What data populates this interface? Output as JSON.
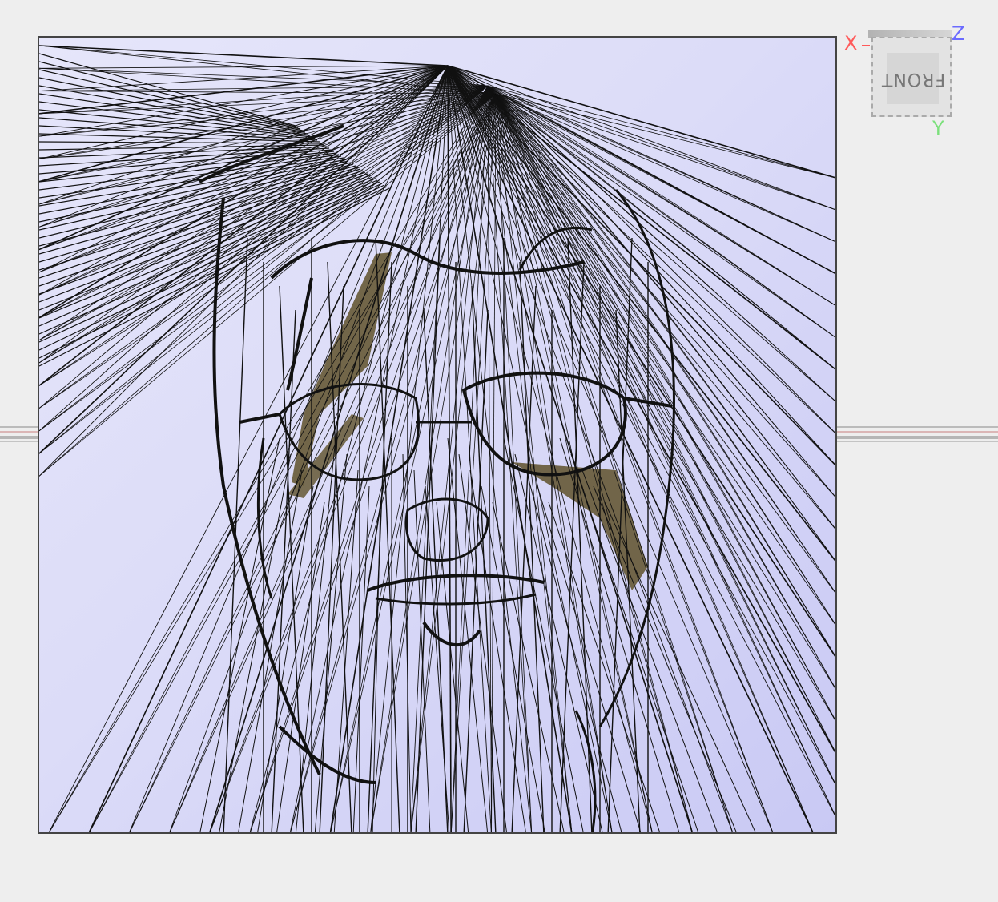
{
  "viewport": {
    "background": "#eeeeee",
    "model_fill": "#dcdcf8",
    "wire_color": "#111111",
    "accent_fill": "#6b5f3f"
  },
  "nav_cube": {
    "face_label": "FRONT",
    "axis_x": "X",
    "axis_y": "Y",
    "axis_z": "Z",
    "axis_x_color": "#ff5a5a",
    "axis_y_color": "#7be07b",
    "axis_z_color": "#6b6bff"
  }
}
